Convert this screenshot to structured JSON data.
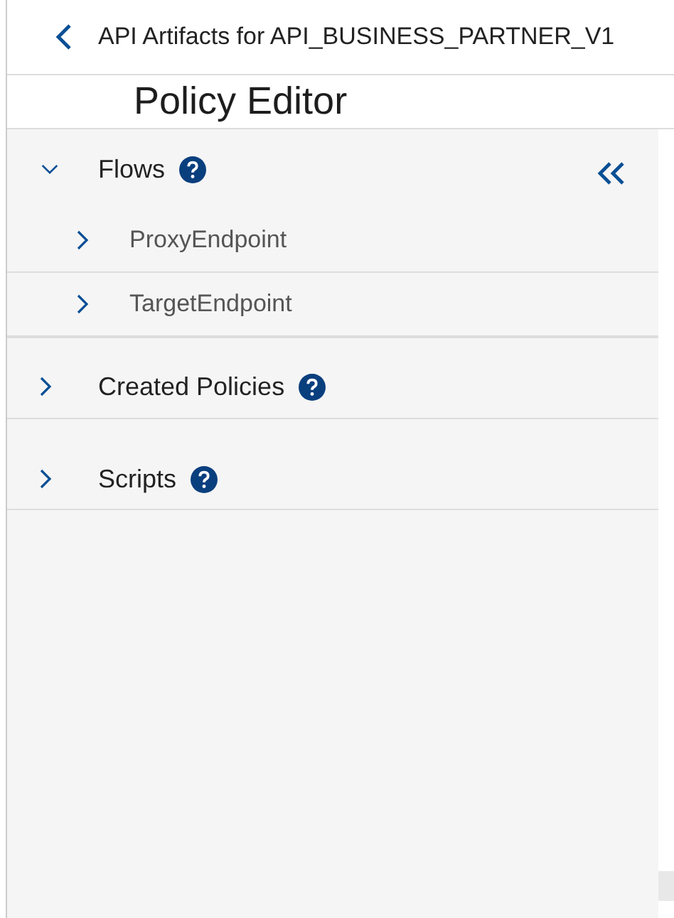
{
  "header": {
    "back": true,
    "title": "API Artifacts for API_BUSINESS_PARTNER_V1"
  },
  "page_title": "Policy Editor",
  "sidebar": {
    "collapse_button": true,
    "sections": [
      {
        "label": "Flows",
        "help": true,
        "expanded": true,
        "children": [
          {
            "label": "ProxyEndpoint",
            "expanded": false
          },
          {
            "label": "TargetEndpoint",
            "expanded": false
          }
        ]
      },
      {
        "label": "Created Policies",
        "help": true,
        "expanded": false
      },
      {
        "label": "Scripts",
        "help": true,
        "expanded": false
      }
    ]
  }
}
